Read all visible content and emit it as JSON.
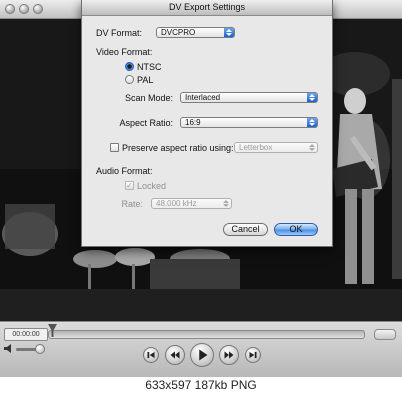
{
  "player": {
    "timecode": "00:00:00"
  },
  "caption": "633x597 187kb PNG",
  "dialog": {
    "title": "DV Export Settings",
    "dv_format": {
      "label": "DV Format:",
      "value": "DVCPRO"
    },
    "video_format": {
      "label": "Video Format:",
      "options": [
        {
          "label": "NTSC",
          "selected": true
        },
        {
          "label": "PAL",
          "selected": false
        }
      ]
    },
    "scan_mode": {
      "label": "Scan Mode:",
      "value": "Interlaced"
    },
    "aspect_ratio": {
      "label": "Aspect Ratio:",
      "value": "16:9"
    },
    "preserve": {
      "label": "Preserve aspect ratio using:",
      "checked": false,
      "value": "Letterbox"
    },
    "audio_format": {
      "label": "Audio Format:",
      "locked": {
        "label": "Locked",
        "checked": true,
        "enabled": false
      },
      "rate": {
        "label": "Rate:",
        "value": "48.000 kHz"
      }
    },
    "cancel_label": "Cancel",
    "ok_label": "OK"
  },
  "colors": {
    "accent": "#3f80e0",
    "dialog_bg": "#e8e8e8",
    "video_bg": "#0f0f0f"
  }
}
